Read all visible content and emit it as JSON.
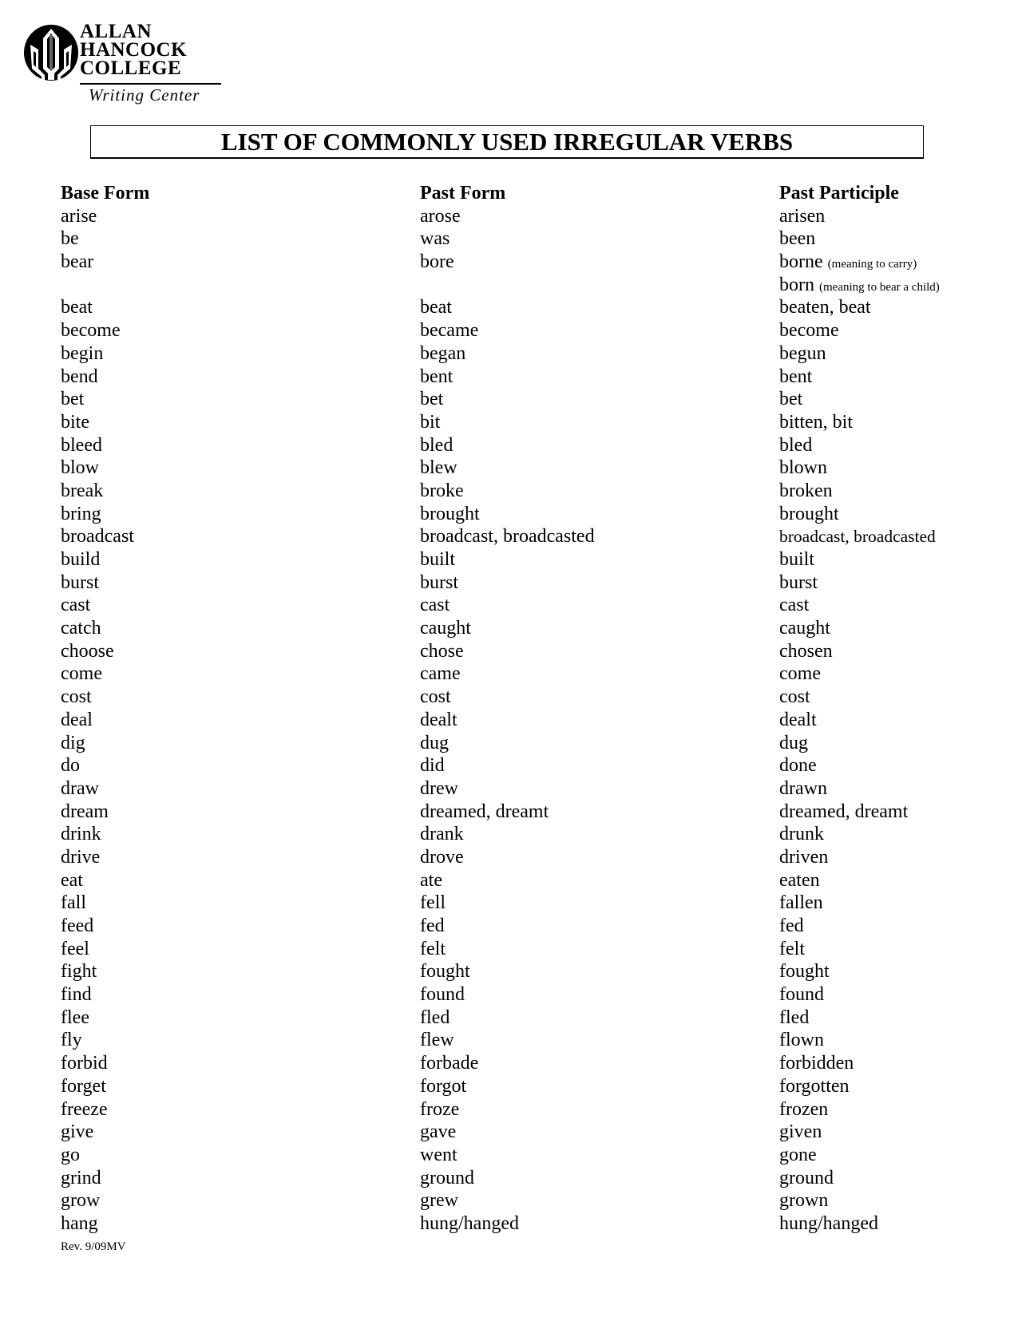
{
  "logo": {
    "lines": [
      "ALLAN",
      "HANCOCK",
      "COLLEGE"
    ],
    "subtitle": "Writing Center",
    "icon": "college-emblem-icon"
  },
  "title": "LIST OF COMMONLY USED IRREGULAR VERBS",
  "columns": {
    "base_header": "Base Form",
    "past_header": "Past Form",
    "pp_header": "Past Participle"
  },
  "rows": [
    {
      "base": "arise",
      "past": "arose",
      "pp": "arisen"
    },
    {
      "base": "be",
      "past": "was",
      "pp": "been"
    },
    {
      "base": "bear",
      "past": "bore",
      "pp": "borne",
      "pp_note": "(meaning to carry)"
    },
    {
      "base": "",
      "past": "",
      "pp": "born",
      "pp_note": "(meaning to bear a child)"
    },
    {
      "base": "beat",
      "past": "beat",
      "pp": "beaten, beat"
    },
    {
      "base": "become",
      "past": "became",
      "pp": "become"
    },
    {
      "base": "begin",
      "past": "began",
      "pp": "begun"
    },
    {
      "base": "bend",
      "past": "bent",
      "pp": "bent"
    },
    {
      "base": "bet",
      "past": "bet",
      "pp": "bet"
    },
    {
      "base": "bite",
      "past": "bit",
      "pp": "bitten, bit"
    },
    {
      "base": "bleed",
      "past": "bled",
      "pp": "bled"
    },
    {
      "base": "blow",
      "past": "blew",
      "pp": "blown"
    },
    {
      "base": "break",
      "past": "broke",
      "pp": "broken"
    },
    {
      "base": "bring",
      "past": "brought",
      "pp": "brought"
    },
    {
      "base": "broadcast",
      "past": "broadcast, broadcasted",
      "pp": "broadcast, broadcasted",
      "pp_small": true
    },
    {
      "base": "build",
      "past": "built",
      "pp": "built"
    },
    {
      "base": "burst",
      "past": "burst",
      "pp": "burst"
    },
    {
      "base": "cast",
      "past": "cast",
      "pp": "cast"
    },
    {
      "base": "catch",
      "past": "caught",
      "pp": "caught"
    },
    {
      "base": "choose",
      "past": "chose",
      "pp": "chosen"
    },
    {
      "base": "come",
      "past": "came",
      "pp": "come"
    },
    {
      "base": "cost",
      "past": "cost",
      "pp": "cost"
    },
    {
      "base": "deal",
      "past": "dealt",
      "pp": "dealt"
    },
    {
      "base": "dig",
      "past": "dug",
      "pp": "dug"
    },
    {
      "base": "do",
      "past": "did",
      "pp": "done"
    },
    {
      "base": "draw",
      "past": "drew",
      "pp": "drawn"
    },
    {
      "base": "dream",
      "past": "dreamed, dreamt",
      "pp": "dreamed, dreamt"
    },
    {
      "base": "drink",
      "past": "drank",
      "pp": "drunk"
    },
    {
      "base": "drive",
      "past": "drove",
      "pp": "driven"
    },
    {
      "base": "eat",
      "past": "ate",
      "pp": "eaten"
    },
    {
      "base": "fall",
      "past": "fell",
      "pp": "fallen"
    },
    {
      "base": "feed",
      "past": "fed",
      "pp": "fed"
    },
    {
      "base": "feel",
      "past": "felt",
      "pp": "felt"
    },
    {
      "base": "fight",
      "past": "fought",
      "pp": "fought"
    },
    {
      "base": "find",
      "past": "found",
      "pp": "found"
    },
    {
      "base": "flee",
      "past": "fled",
      "pp": "fled"
    },
    {
      "base": "fly",
      "past": "flew",
      "pp": "flown"
    },
    {
      "base": "forbid",
      "past": "forbade",
      "pp": "forbidden"
    },
    {
      "base": "forget",
      "past": "forgot",
      "pp": "forgotten"
    },
    {
      "base": "freeze",
      "past": "froze",
      "pp": "frozen"
    },
    {
      "base": "give",
      "past": "gave",
      "pp": "given"
    },
    {
      "base": "go",
      "past": "went",
      "pp": "gone"
    },
    {
      "base": "grind",
      "past": "ground",
      "pp": "ground"
    },
    {
      "base": "grow",
      "past": "grew",
      "pp": "grown"
    },
    {
      "base": "hang",
      "past": "hung/hanged",
      "pp": "hung/hanged"
    }
  ],
  "footer": "Rev. 9/09MV"
}
